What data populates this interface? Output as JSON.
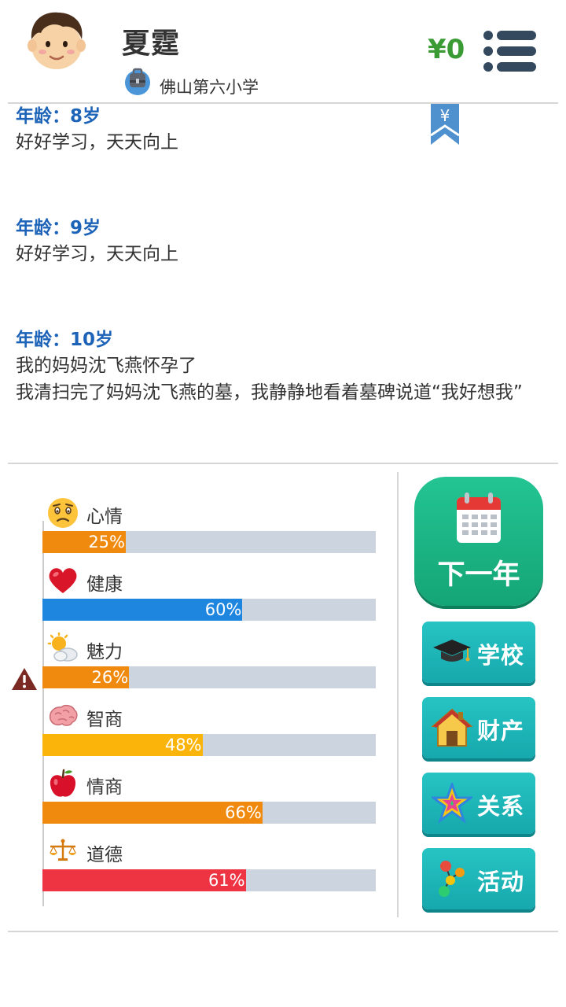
{
  "header": {
    "player_name": "夏霆",
    "school": "佛山第六小学",
    "money": "¥0"
  },
  "log": {
    "bookmark_symbol": "¥",
    "entries": [
      {
        "age": "年龄：8岁",
        "lines": [
          "好好学习，天天向上"
        ]
      },
      {
        "age": "年龄：9岁",
        "lines": [
          "好好学习，天天向上"
        ]
      },
      {
        "age": "年龄：10岁",
        "lines": [
          "我的妈妈沈飞燕怀孕了",
          "我清扫完了妈妈沈飞燕的墓，我静静地看着墓碑说道“我好想我”"
        ]
      }
    ]
  },
  "stats": [
    {
      "label": "心情",
      "value": 25,
      "pct_text": "25%",
      "color": "#f08a0f",
      "icon": "worried-face-icon"
    },
    {
      "label": "健康",
      "value": 60,
      "pct_text": "60%",
      "color": "#1f86e0",
      "icon": "heart-icon"
    },
    {
      "label": "魅力",
      "value": 26,
      "pct_text": "26%",
      "color": "#f08a0f",
      "icon": "sun-cloud-icon",
      "warning": true
    },
    {
      "label": "智商",
      "value": 48,
      "pct_text": "48%",
      "color": "#fbb40a",
      "icon": "brain-icon"
    },
    {
      "label": "情商",
      "value": 66,
      "pct_text": "66%",
      "color": "#f08a0f",
      "icon": "apple-icon"
    },
    {
      "label": "道德",
      "value": 61,
      "pct_text": "61%",
      "color": "#ee3343",
      "icon": "scales-icon"
    }
  ],
  "actions": {
    "next_year": "下一年",
    "school": "学校",
    "property": "财产",
    "relations": "关系",
    "activities": "活动"
  },
  "colors": {
    "money": "#3a9a34",
    "age_heading": "#1d63b8",
    "next_year_bg": "#1cb584",
    "side_button_bg": "#1eb6b8",
    "bar_track": "#ccd5df"
  }
}
